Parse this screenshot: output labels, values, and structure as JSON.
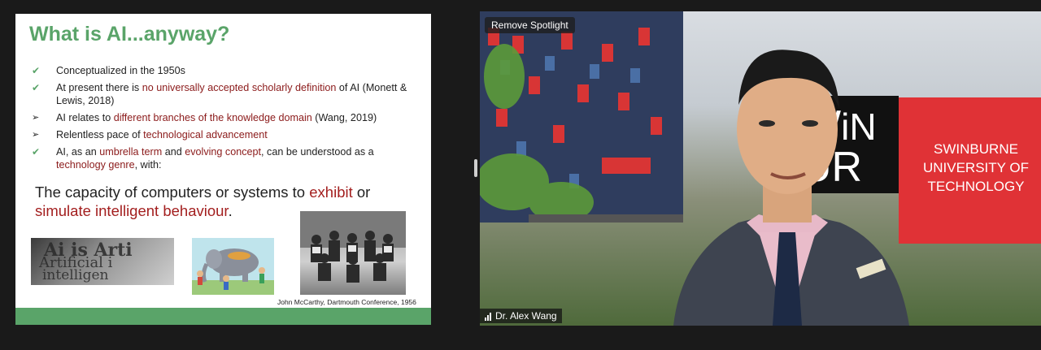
{
  "slide": {
    "title": "What is AI...anyway?",
    "bullets": [
      {
        "marker": "check",
        "parts": [
          {
            "t": "Conceptualized in the 1950s",
            "hl": false
          }
        ]
      },
      {
        "marker": "check",
        "parts": [
          {
            "t": "At present there is ",
            "hl": false
          },
          {
            "t": "no universally accepted scholarly definition",
            "hl": true
          },
          {
            "t": " of AI (Monett & Lewis, 2018)",
            "hl": false
          }
        ]
      },
      {
        "marker": "arrow",
        "parts": [
          {
            "t": "AI relates to ",
            "hl": false
          },
          {
            "t": "different branches of the knowledge domain",
            "hl": true
          },
          {
            "t": " (Wang, 2019)",
            "hl": false
          }
        ]
      },
      {
        "marker": "arrow",
        "parts": [
          {
            "t": "Relentless pace of ",
            "hl": false
          },
          {
            "t": "technological advancement",
            "hl": true
          }
        ]
      },
      {
        "marker": "check",
        "parts": [
          {
            "t": "AI, as an ",
            "hl": false
          },
          {
            "t": "umbrella term",
            "hl": true
          },
          {
            "t": " and ",
            "hl": false
          },
          {
            "t": "evolving concept",
            "hl": true
          },
          {
            "t": ", can be understood as a ",
            "hl": false
          },
          {
            "t": "technology genre",
            "hl": true
          },
          {
            "t": ", with:",
            "hl": false
          }
        ]
      }
    ],
    "statement": [
      {
        "t": "The capacity of computers or systems to ",
        "hl": false
      },
      {
        "t": "exhibit",
        "hl": true
      },
      {
        "t": " or ",
        "hl": false
      },
      {
        "t": "simulate intelligent behaviour",
        "hl": true
      },
      {
        "t": ".",
        "hl": false
      }
    ],
    "image_words": [
      "Ai is Arti",
      "Artificial i",
      "intelligen"
    ],
    "caption": "John McCarthy, Dartmouth Conference, 1956"
  },
  "video": {
    "spotlight_label": "Remove Spotlight",
    "participant_name": "Dr. Alex Wang",
    "sign_black_text": "WiN\nUR",
    "sign_text": "SWINBURNE\nUNIVERSITY OF\nTECHNOLOGY"
  },
  "colors": {
    "title_green": "#5aa469",
    "highlight_red": "#8b1a1a",
    "sign_red": "#e03236"
  }
}
